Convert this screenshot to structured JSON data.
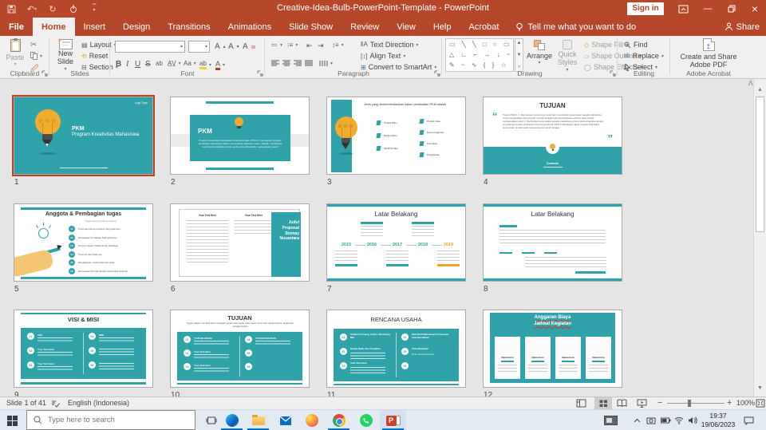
{
  "titlebar": {
    "title": "Creative-Idea-Bulb-PowerPoint-Template  -  PowerPoint",
    "sign_in": "Sign in"
  },
  "tabs": [
    "File",
    "Home",
    "Insert",
    "Design",
    "Transitions",
    "Animations",
    "Slide Show",
    "Review",
    "View",
    "Help",
    "Acrobat"
  ],
  "tell_me": "Tell me what you want to do",
  "share_label": "Share",
  "ribbon": {
    "clipboard": {
      "label": "Clipboard",
      "paste": "Paste"
    },
    "slides": {
      "label": "Slides",
      "new_slide": "New Slide",
      "layout": "Layout",
      "reset": "Reset",
      "section": "Section"
    },
    "font": {
      "label": "Font"
    },
    "paragraph": {
      "label": "Paragraph",
      "text_direction": "Text Direction",
      "align_text": "Align Text",
      "convert": "Convert to SmartArt"
    },
    "drawing": {
      "label": "Drawing",
      "arrange": "Arrange",
      "quick_styles": "Quick Styles",
      "shape_fill": "Shape Fill",
      "shape_outline": "Shape Outline",
      "shape_effects": "Shape Effects"
    },
    "editing": {
      "label": "Editing",
      "find": "Find",
      "replace": "Replace",
      "select": "Select"
    },
    "acrobat": {
      "label": "Adobe Acrobat",
      "create": "Create and Share Adobe PDF"
    }
  },
  "badges": [
    "01",
    "02",
    "03",
    "04",
    "05",
    "06"
  ],
  "slides": [
    {
      "n": "1",
      "logo": "Logo Type",
      "title": "PKM",
      "subtitle": "Program Kreativitas Mahasiswa"
    },
    {
      "n": "2",
      "title": "PKM",
      "body": "Program Kreativitas Mahasiswa Kewirausahaan (PKM-K) merupakan program kreativitas mahasiswa dalam menciptakan aktivitas usaha. Melatih mahasiswa membuat kreativitas produk usaha yang dibutuhkan masyarakat (pasar)"
    },
    {
      "n": "3",
      "title": "Jenis yang direkomendasikan dalam pembuatan PKM adalah",
      "left": [
        "Produk Baru",
        "Barang Baru",
        "Modif Produk"
      ],
      "right": [
        "Produk Jasa",
        "Event Organizer",
        "Konsultan",
        "Pengolahan"
      ]
    },
    {
      "n": "4",
      "title": "TUJUAN",
      "body": "Tujuan PKM-K: 1. Memotivasi (mendorong minat) dan memberikan kesempatan kepada mahasiswa untuk menghasilkan karya kreatif, inovatif sebagai bekal berwirausaha sebelum atau setelah menyelesaikan studi; 2. Memberikan kesempatan kepada mahasiswa untuk praktik wirausaha dengan pemahaman konsep wirausaha yang komprehensif. PKM-K diharapkan dapat menjadi cikal bakal kemunculan produk usaha sebagai karya mandiri bangsa",
      "button": "Contents"
    },
    {
      "n": "5",
      "title": "Anggota & Pembagian tugas",
      "subtitle": "Tugas masing masing masing",
      "items": [
        "Proposal Dwi Ayu Aulia & Supriyatmono",
        "Pengadaan Peralatan Supriyatmono",
        "Survey Lokasi Usaha Sendi Setiawan",
        "Promosi Oka Wahyuni",
        "Menjalankan Usaha Dwi Ayu Aulia",
        "Pemasaran Produk Shadu Khoirunisa Daniyah"
      ]
    },
    {
      "n": "6",
      "col1_head": "Your Text Here",
      "col2_head": "Your Text Here",
      "panel": "Judul Proposal Siomay Nusantara"
    },
    {
      "n": "7",
      "title": "Latar Belakang",
      "years": [
        "2015",
        "2016",
        "2017",
        "2018",
        "2019"
      ]
    },
    {
      "n": "8",
      "title": "Latar Belakang"
    },
    {
      "n": "9",
      "title": "VISI & MISI",
      "left_head": "VISI",
      "right_head": "MISI",
      "item_head": "Your Text Here"
    },
    {
      "n": "10",
      "title": "TUJUAN",
      "subtitle": "Tujuan dalam membuat bisnis sebagai menjadi dua tujuan yaitu tujuan umum dan tujuan khusus, antara lain sebagai berikut",
      "left_head": "TUJUAN UMUM",
      "right_head": "TUJUAN KHUSUS",
      "item_head": "Your Text Here"
    },
    {
      "n": "11",
      "title": "RENCANA USAHA",
      "left_items": [
        "Analisis Peluang Usaha: Marketing Mix",
        "Bahan Baku dan Peralatan",
        "Your Text Here"
      ],
      "right_items": [
        "Metode Pelaksanaan Pemasaran Alat dan Bahan",
        "Cara Membuat",
        "Dokumentasi Produk"
      ]
    },
    {
      "n": "12",
      "title_line1": "Anggaran Biaya",
      "title_line2": "Jadwal Kegiatan",
      "card_head": "Nama Item"
    }
  ],
  "statusbar": {
    "slide_info": "Slide 1 of 41",
    "language": "English (Indonesia)",
    "zoom_level": "100%"
  },
  "taskbar": {
    "search_placeholder": "Type here to search",
    "time": "19:37",
    "date": "19/06/2023"
  },
  "colors": {
    "accent": "#B7472A",
    "teal": "#2FA3A9",
    "bulb_yellow": "#F0AC2E",
    "timeline_orange": "#EFA229",
    "taskbar_accent": "#0078D7"
  }
}
